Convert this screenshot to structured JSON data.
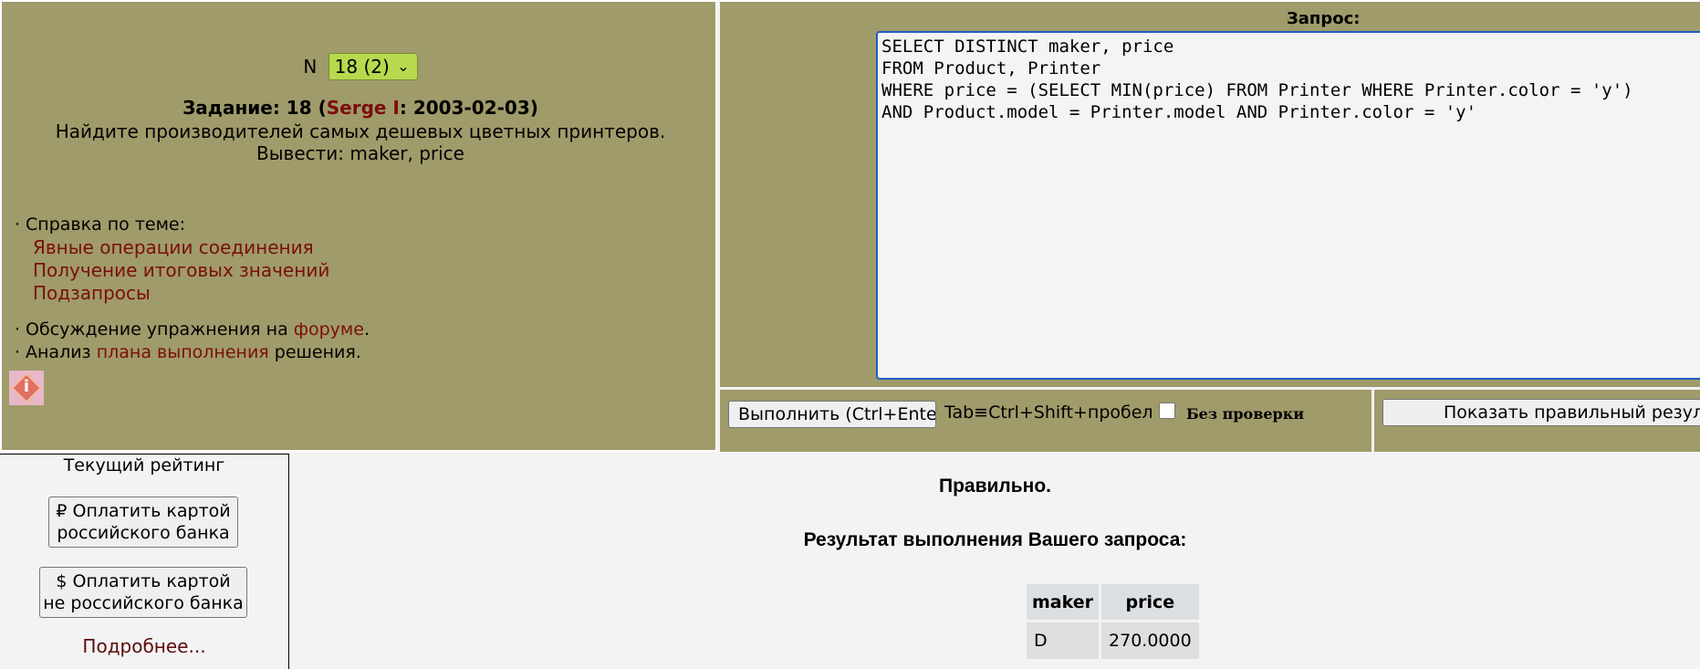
{
  "task_selector": {
    "label": "N",
    "selected": "18 (2)"
  },
  "task": {
    "prefix": "Задание: 18 (",
    "author": "Serge I",
    "suffix": ": 2003-02-03)",
    "text": "Найдите производителей самых дешевых цветных принтеров. Вывести: maker, price"
  },
  "help": {
    "heading": "Справка по теме:",
    "links": [
      "Явные операции соединения",
      "Получение итоговых значений",
      "Подзапросы"
    ],
    "discussion_prefix": "Обсуждение упражнения на ",
    "discussion_link": "форуме",
    "discussion_suffix": ".",
    "analysis_prefix": "Анализ ",
    "analysis_link": "плана выполнения",
    "analysis_suffix": " решения."
  },
  "query": {
    "label": "Запрос:",
    "text": "SELECT DISTINCT maker, price\nFROM Product, Printer\nWHERE price = (SELECT MIN(price) FROM Printer WHERE Printer.color = 'y')\nAND Product.model = Printer.model AND Printer.color = 'y'"
  },
  "toolbar": {
    "run_label": "Выполнить (Ctrl+Enter)",
    "tab_hint": "Tab≡Ctrl+Shift+пробел",
    "noverify_label": "Без  проверки",
    "show_correct_label": "Показать правильный результат"
  },
  "rating": {
    "title": "Текущий рейтинг",
    "pay_rub_line1": "₽ Оплатить картой",
    "pay_rub_line2": "российского банка",
    "pay_usd_line1": "$ Оплатить картой",
    "pay_usd_line2": "не российского банка",
    "more": "Подробнее..."
  },
  "result": {
    "verdict": "Правильно.",
    "title": "Результат выполнения Вашего запроса:",
    "columns": [
      "maker",
      "price"
    ],
    "rows": [
      [
        "D",
        "270.0000"
      ]
    ]
  },
  "colors": {
    "panel_bg": "#a09b6a",
    "link": "#7b0e0e",
    "select_bg": "#b8d94e",
    "query_border": "#1f5fbf"
  }
}
